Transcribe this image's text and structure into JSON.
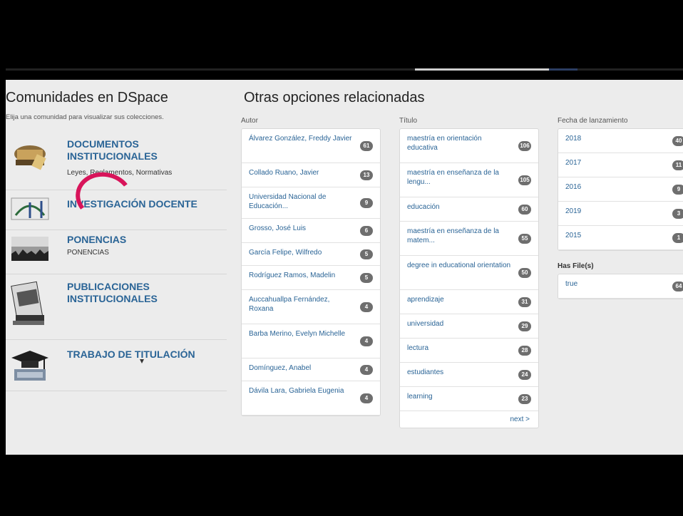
{
  "colors": {
    "link": "#2a6496",
    "badge": "#6e6e6e",
    "annotation": "#d8145a"
  },
  "communities": {
    "title": "Comunidades en DSpace",
    "subtitle": "Elija una comunidad para visualizar sus colecciones.",
    "items": [
      {
        "title": "DOCUMENTOS INSTITUCIONALES",
        "desc": "Leyes, Reglamentos, Normativas",
        "icon": "books-stack-icon"
      },
      {
        "title": "INVESTIGACIÓN DOCENTE",
        "desc": "",
        "icon": "research-icon"
      },
      {
        "title": "PONENCIAS",
        "desc": "PONENCIAS",
        "icon": "conference-icon"
      },
      {
        "title": "PUBLICACIONES INSTITUCIONALES",
        "desc": "",
        "icon": "publications-icon"
      },
      {
        "title": "TRABAJO DE TITULACIÓN",
        "desc": "",
        "icon": "graduation-cap-icon"
      }
    ]
  },
  "related": {
    "title": "Otras opciones relacionadas",
    "autor": {
      "heading": "Autor",
      "items": [
        {
          "label": "Álvarez González, Freddy Javier",
          "count": "61"
        },
        {
          "label": "Collado Ruano, Javier",
          "count": "13"
        },
        {
          "label": "Universidad Nacional de Educación...",
          "count": "9"
        },
        {
          "label": "Grosso, José Luis",
          "count": "6"
        },
        {
          "label": "García Felipe, Wilfredo",
          "count": "5"
        },
        {
          "label": "Rodríguez Ramos, Madelin",
          "count": "5"
        },
        {
          "label": "Aucca­huallpa Fernández, Roxana",
          "count": "4"
        },
        {
          "label": "Barba Merino, Evelyn Michelle",
          "count": "4"
        },
        {
          "label": "Domínguez, Anabel",
          "count": "4"
        },
        {
          "label": "Dávila Lara, Gabriela Eugenia",
          "count": "4"
        }
      ]
    },
    "titulo": {
      "heading": "Título",
      "items": [
        {
          "label": "maestría en orientación educativa",
          "count": "106"
        },
        {
          "label": "maestría en enseñanza de la lengu...",
          "count": "105"
        },
        {
          "label": "educación",
          "count": "60"
        },
        {
          "label": "maestría en enseñanza de la matem...",
          "count": "55"
        },
        {
          "label": "degree in educational orientation",
          "count": "50"
        },
        {
          "label": "aprendizaje",
          "count": "31"
        },
        {
          "label": "universidad",
          "count": "29"
        },
        {
          "label": "lectura",
          "count": "28"
        },
        {
          "label": "estudiantes",
          "count": "24"
        },
        {
          "label": "learning",
          "count": "23"
        }
      ],
      "next": "next >"
    },
    "fecha": {
      "heading": "Fecha de lanzamiento",
      "items": [
        {
          "label": "2018",
          "count": "40"
        },
        {
          "label": "2017",
          "count": "11"
        },
        {
          "label": "2016",
          "count": "9"
        },
        {
          "label": "2019",
          "count": "3"
        },
        {
          "label": "2015",
          "count": "1"
        }
      ]
    },
    "files": {
      "heading": "Has File(s)",
      "items": [
        {
          "label": "true",
          "count": "64"
        }
      ]
    }
  }
}
